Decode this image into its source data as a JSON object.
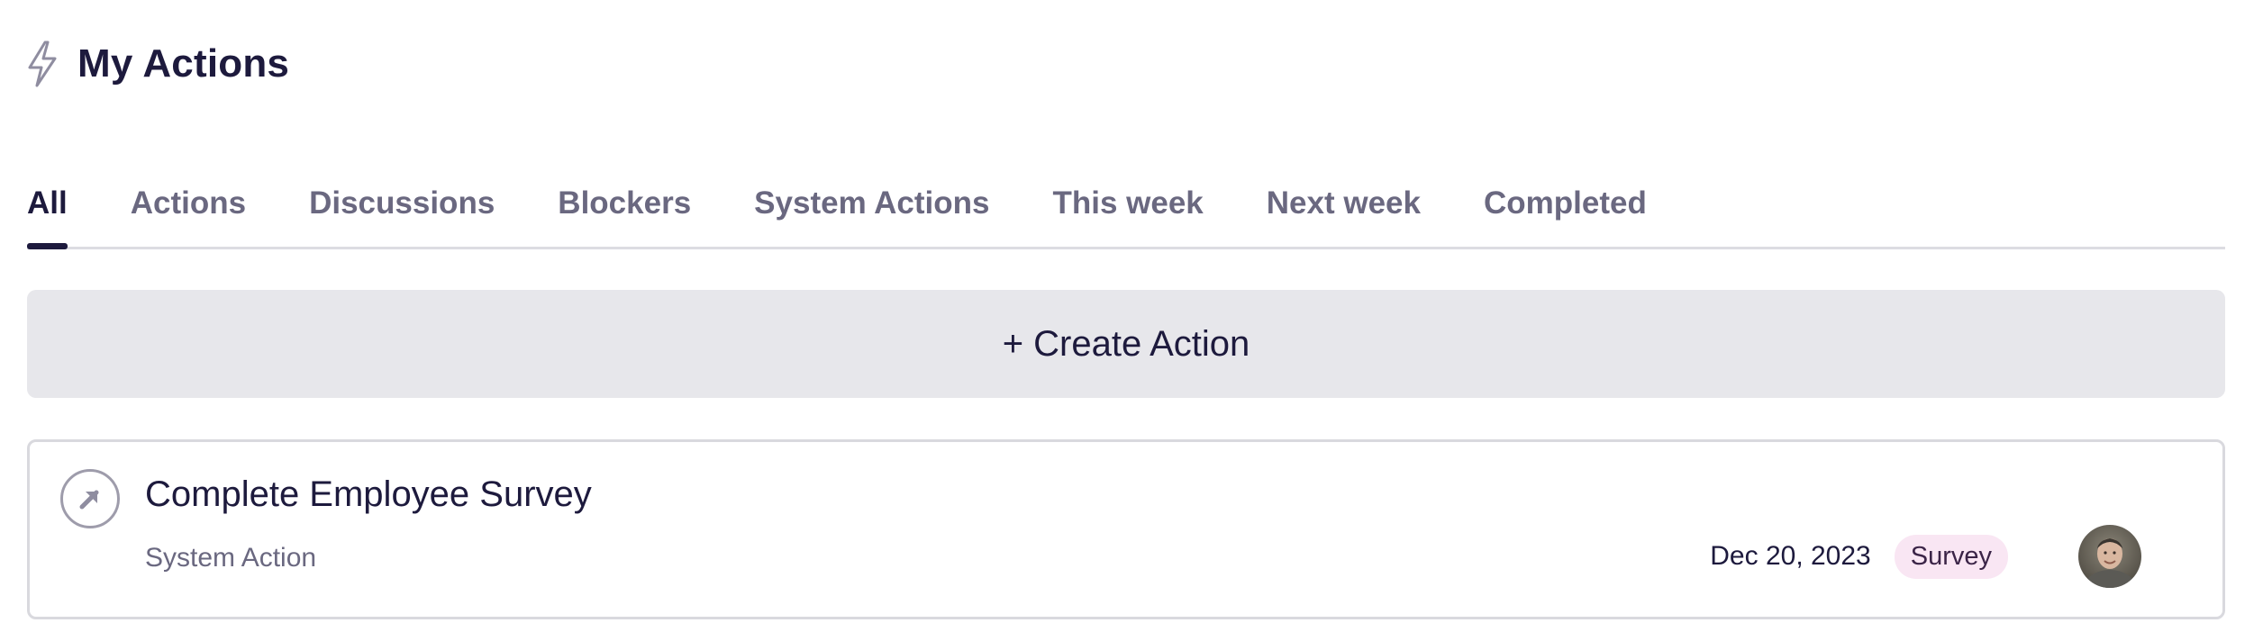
{
  "header": {
    "icon": "lightning-bolt-icon",
    "title": "My Actions"
  },
  "tabs": [
    {
      "label": "All",
      "active": true
    },
    {
      "label": "Actions",
      "active": false
    },
    {
      "label": "Discussions",
      "active": false
    },
    {
      "label": "Blockers",
      "active": false
    },
    {
      "label": "System Actions",
      "active": false
    },
    {
      "label": "This week",
      "active": false
    },
    {
      "label": "Next week",
      "active": false
    },
    {
      "label": "Completed",
      "active": false
    }
  ],
  "create_button": {
    "label": "+ Create Action"
  },
  "actions": [
    {
      "icon": "arrow-up-right-icon",
      "title": "Complete Employee Survey",
      "type": "System Action",
      "due_date": "Dec 20, 2023",
      "tag": "Survey",
      "tag_color": "#f9e6f3",
      "assignee_avatar": "user-avatar"
    }
  ],
  "colors": {
    "text_primary": "#1d1a3d",
    "text_secondary": "#6a6880",
    "button_bg": "#e7e7eb",
    "border": "#d9d9de"
  }
}
